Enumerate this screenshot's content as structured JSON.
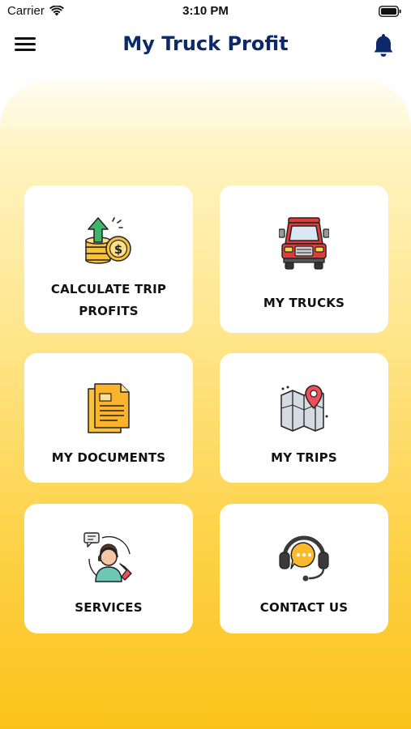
{
  "status": {
    "carrier": "Carrier",
    "time": "3:10 PM"
  },
  "header": {
    "title": "My Truck Profit",
    "menu_icon": "hamburger-menu-icon",
    "bell_icon": "bell-icon"
  },
  "tiles": [
    {
      "label": "CALCULATE TRIP PROFITS",
      "line1": "CALCULATE TRIP",
      "line2": "PROFITS",
      "icon": "coins-growth-icon"
    },
    {
      "label": "MY TRUCKS",
      "icon": "truck-icon"
    },
    {
      "label": "MY DOCUMENTS",
      "icon": "documents-icon"
    },
    {
      "label": "MY TRIPS",
      "icon": "map-pin-icon"
    },
    {
      "label": "SERVICES",
      "icon": "support-agent-icon"
    },
    {
      "label": "CONTACT US",
      "icon": "headset-icon"
    }
  ],
  "colors": {
    "title": "#0c2a6b",
    "accent": "#fbc21a",
    "panel_top": "#fffdf3"
  }
}
